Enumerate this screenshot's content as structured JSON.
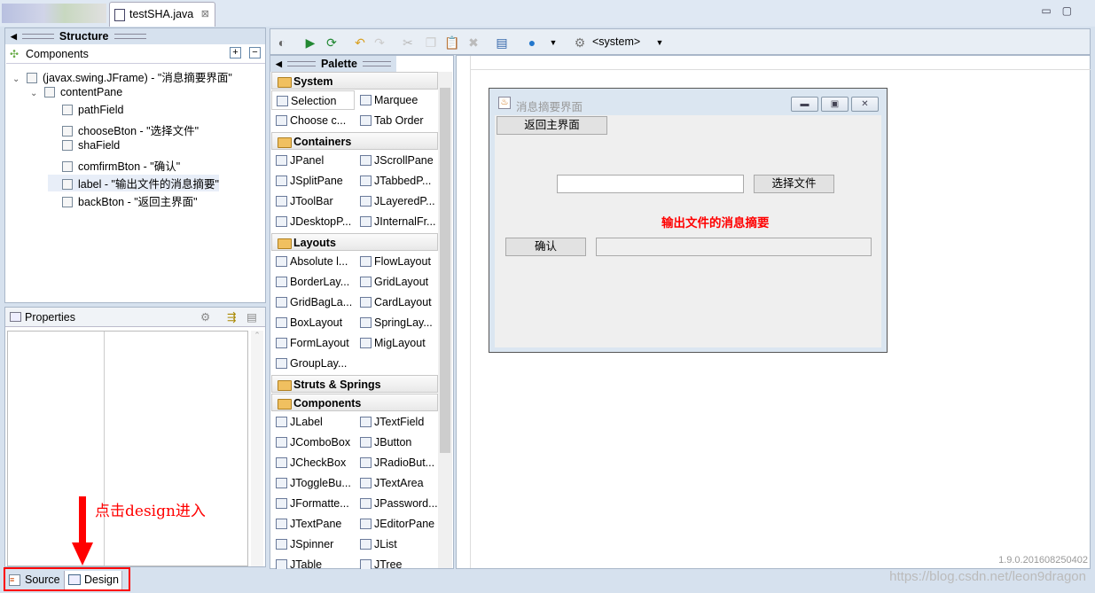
{
  "editor_tab": {
    "label": "testSHA.java",
    "close": "⊠"
  },
  "structure": {
    "title": "Structure",
    "components_label": "Components",
    "tree": [
      {
        "label": "(javax.swing.JFrame) - \"消息摘要界面\"",
        "level": 0,
        "expander": "∨"
      },
      {
        "label": "contentPane",
        "level": 1,
        "expander": "∨"
      },
      {
        "label": "pathField",
        "level": 2
      },
      {
        "label": "chooseBton - \"选择文件\"",
        "level": 2
      },
      {
        "label": "shaField",
        "level": 2
      },
      {
        "label": "comfirmBton - \"确认\"",
        "level": 2
      },
      {
        "label": "label - \"输出文件的消息摘要\"",
        "level": 2,
        "selected": true
      },
      {
        "label": "backBton - \"返回主界面\"",
        "level": 2
      }
    ]
  },
  "properties": {
    "title": "Properties"
  },
  "toolbar": {
    "system_select": "<system>"
  },
  "palette": {
    "title": "Palette",
    "groups": [
      {
        "name": "System",
        "items": [
          "Selection",
          "Marquee",
          "Choose c...",
          "Tab Order"
        ]
      },
      {
        "name": "Containers",
        "items": [
          "JPanel",
          "JScrollPane",
          "JSplitPane",
          "JTabbedP...",
          "JToolBar",
          "JLayeredP...",
          "JDesktopP...",
          "JInternalFr..."
        ]
      },
      {
        "name": "Layouts",
        "items": [
          "Absolute l...",
          "FlowLayout",
          "BorderLay...",
          "GridLayout",
          "GridBagLa...",
          "CardLayout",
          "BoxLayout",
          "SpringLay...",
          "FormLayout",
          "MigLayout",
          "GroupLay..."
        ]
      },
      {
        "name": "Struts & Springs",
        "items": []
      },
      {
        "name": "Components",
        "items": [
          "JLabel",
          "JTextField",
          "JComboBox",
          "JButton",
          "JCheckBox",
          "JRadioBut...",
          "JToggleBu...",
          "JTextArea",
          "JFormatte...",
          "JPassword...",
          "JTextPane",
          "JEditorPane",
          "JSpinner",
          "JList",
          "JTable",
          "JTree"
        ]
      }
    ]
  },
  "design_frame": {
    "title": "消息摘要界面",
    "back_button": "返回主界面",
    "path_field": "",
    "choose_button": "选择文件",
    "output_label": "输出文件的消息摘要",
    "output_label_color": "#ff0000",
    "confirm_button": "确认",
    "sha_field": ""
  },
  "bottom_tabs": {
    "source": "Source",
    "design": "Design",
    "active": "Design"
  },
  "version": "1.9.0.201608250402",
  "watermark": "https://blog.csdn.net/leon9dragon",
  "annotation": "点击design进入"
}
